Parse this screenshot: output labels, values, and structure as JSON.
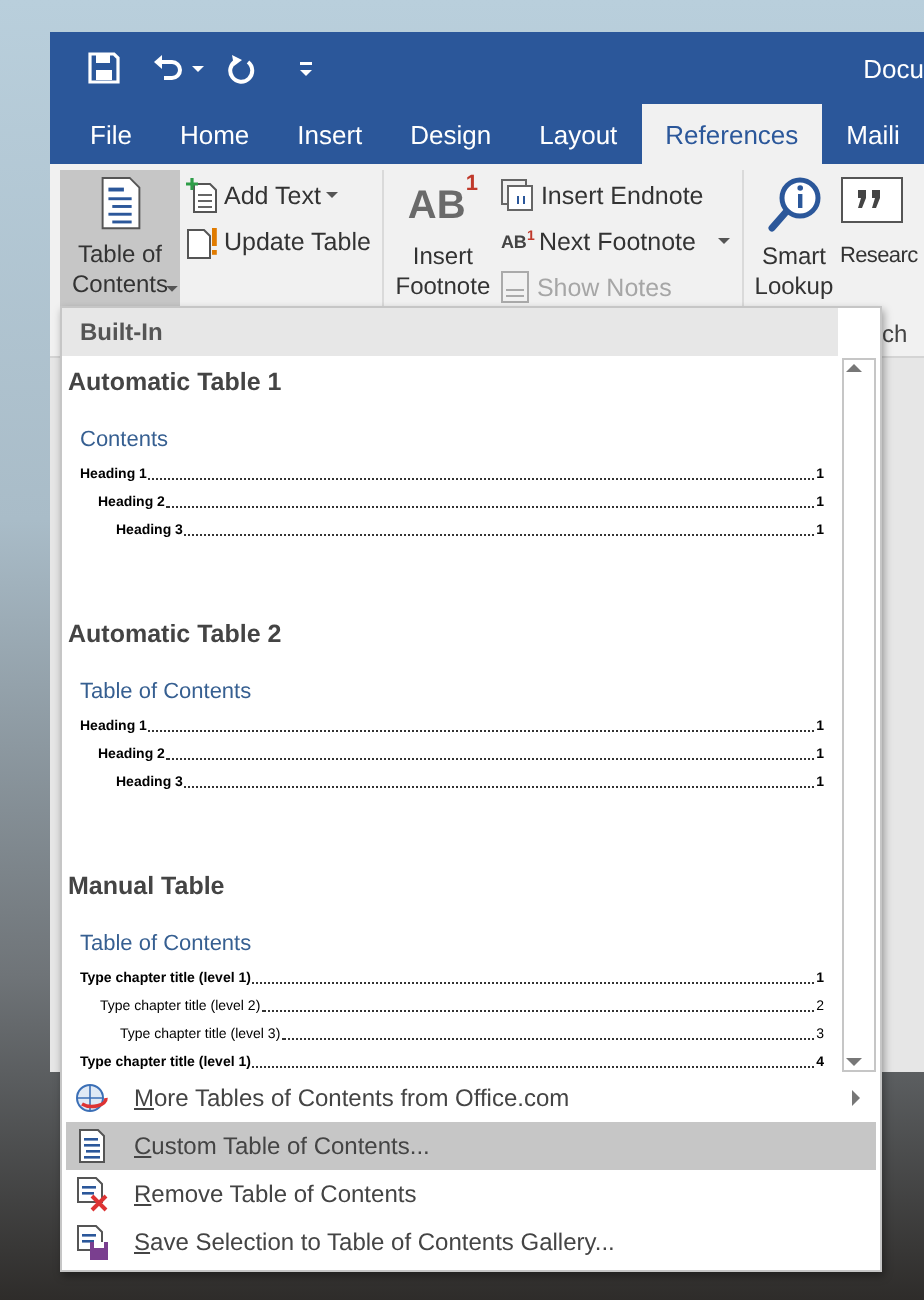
{
  "window": {
    "title": "Docu"
  },
  "tabs": [
    {
      "label": "File",
      "selected": false
    },
    {
      "label": "Home",
      "selected": false
    },
    {
      "label": "Insert",
      "selected": false
    },
    {
      "label": "Design",
      "selected": false
    },
    {
      "label": "Layout",
      "selected": false
    },
    {
      "label": "References",
      "selected": true
    },
    {
      "label": "Maili",
      "selected": false
    }
  ],
  "ribbon": {
    "table_of_contents": {
      "label": "Table of Contents",
      "pressed": true
    },
    "toc_buttons": [
      {
        "label": "Add Text",
        "dropdown": true
      },
      {
        "label": "Update Table",
        "dropdown": false
      }
    ],
    "insert_footnote": {
      "glyph": "AB$^{1}$",
      "label": "Insert Footnote"
    },
    "footnote_buttons": [
      {
        "kind": "endnote",
        "label": "Insert Endnote",
        "disabled": false,
        "dropdown": false
      },
      {
        "kind": "next",
        "glyph": "AB$^{1}$",
        "label": "Next Footnote",
        "disabled": false,
        "dropdown": true
      },
      {
        "kind": "notes",
        "label": "Show Notes",
        "disabled": true,
        "dropdown": false
      }
    ],
    "smart_lookup": {
      "label": "Smart Lookup"
    },
    "research": {
      "label": "Researc"
    },
    "group_label": "ch"
  },
  "menu": {
    "section_header": "Built-In",
    "gallery": [
      {
        "kind": "automatic",
        "title": "Automatic Table 1",
        "heading": "Contents",
        "entries": [
          {
            "text": "Heading 1",
            "page": "1",
            "children": [
              {
                "text": "Heading 2",
                "page": "1",
                "children": [
                  {
                    "text": "Heading 3",
                    "page": "1"
                  }
                ]
              }
            ]
          }
        ]
      },
      {
        "kind": "automatic",
        "title": "Automatic Table 2",
        "heading": "Table of Contents",
        "entries": [
          {
            "text": "Heading 1",
            "page": "1",
            "children": [
              {
                "text": "Heading 2",
                "page": "1",
                "children": [
                  {
                    "text": "Heading 3",
                    "page": "1"
                  }
                ]
              }
            ]
          }
        ]
      },
      {
        "kind": "manual",
        "title": "Manual Table",
        "heading": "Table of Contents",
        "entries": [
          {
            "text": "Type chapter title (level 1)",
            "page": "1",
            "children": [
              {
                "text": "Type chapter title (level 2)",
                "page": "2",
                "children": [
                  {
                    "text": "Type chapter title (level 3)",
                    "page": "3"
                  }
                ]
              }
            ]
          },
          {
            "text": "Type chapter title (level 1)",
            "page": "4"
          }
        ]
      }
    ],
    "actions": [
      {
        "kind": "online",
        "label": "More Tables of Contents from Office.com",
        "submenu": true,
        "selected": false
      },
      {
        "kind": "custom",
        "label": "Custom Table of Contents...",
        "submenu": false,
        "selected": true
      },
      {
        "kind": "remove",
        "label": "Remove Table of Contents",
        "submenu": false,
        "selected": false
      },
      {
        "kind": "save",
        "label": "Save Selection to Table of Contents Gallery...",
        "submenu": false,
        "selected": false
      }
    ]
  }
}
